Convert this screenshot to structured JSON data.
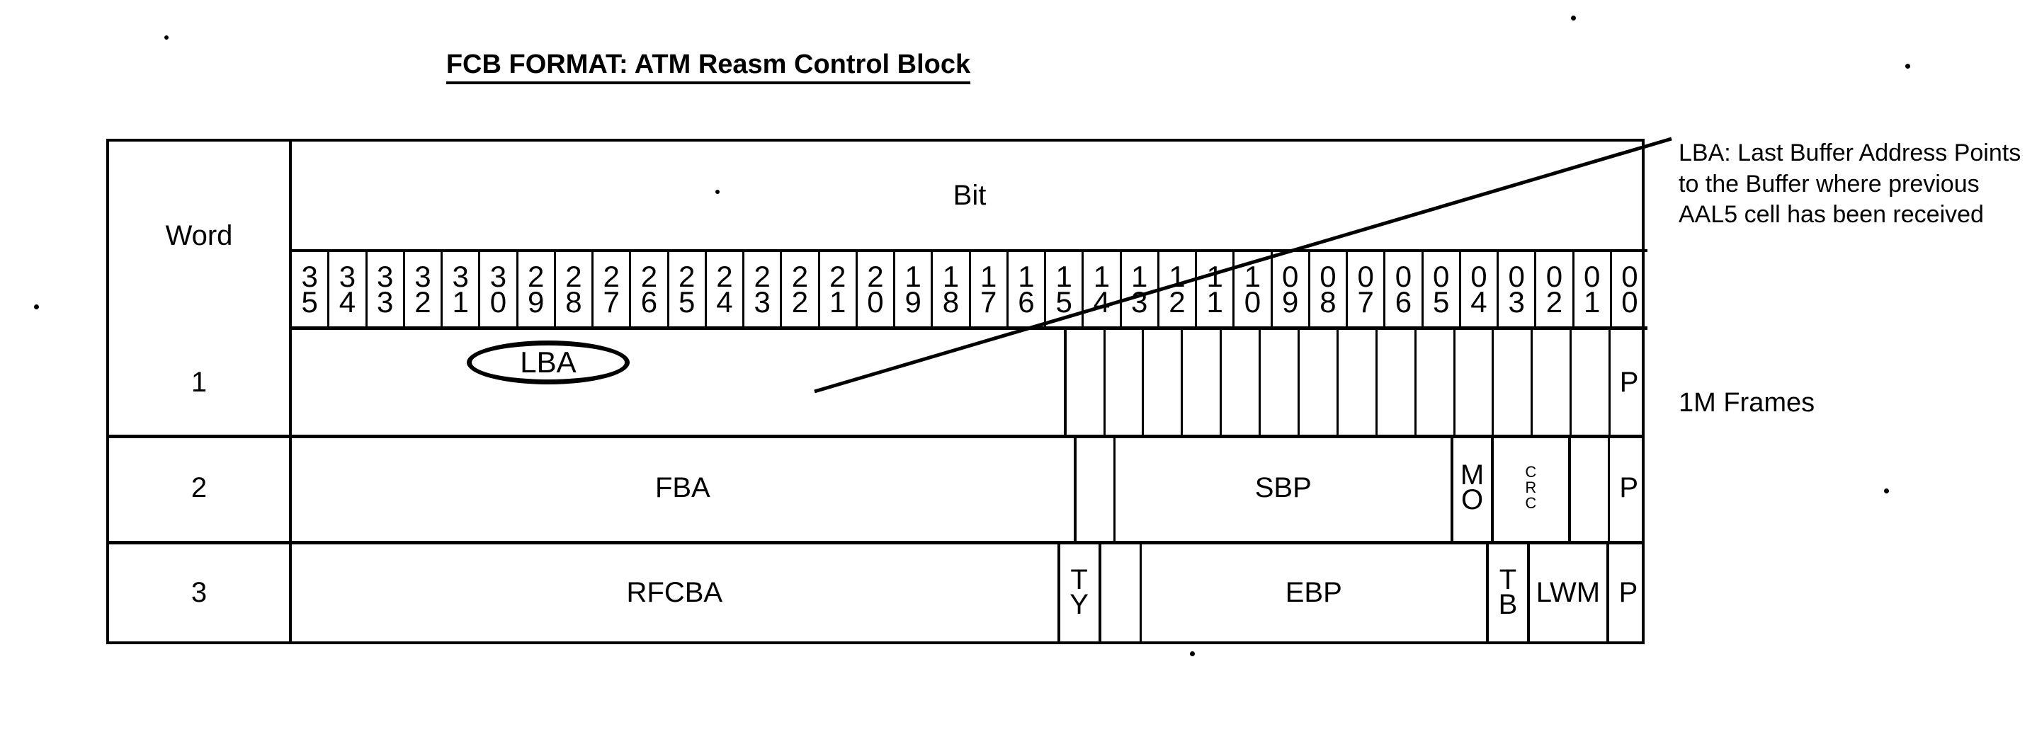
{
  "title": "FCB FORMAT: ATM Reasm Control Block",
  "table": {
    "word_header": "Word",
    "bit_header": "Bit",
    "bit_numbers": [
      "35",
      "34",
      "33",
      "32",
      "31",
      "30",
      "29",
      "28",
      "27",
      "26",
      "25",
      "24",
      "23",
      "22",
      "21",
      "20",
      "19",
      "18",
      "17",
      "16",
      "15",
      "14",
      "13",
      "12",
      "11",
      "10",
      "09",
      "08",
      "07",
      "06",
      "05",
      "04",
      "03",
      "02",
      "01",
      "00"
    ],
    "rows": [
      {
        "word": "1",
        "fields": [
          {
            "label": "LBA",
            "bits": 21,
            "style": "ellipse"
          },
          {
            "label": "",
            "bits": 1,
            "style": "blank"
          },
          {
            "label": "",
            "bits": 1,
            "style": "blank"
          },
          {
            "label": "",
            "bits": 1,
            "style": "blank"
          },
          {
            "label": "",
            "bits": 1,
            "style": "blank"
          },
          {
            "label": "",
            "bits": 1,
            "style": "blank"
          },
          {
            "label": "",
            "bits": 1,
            "style": "blank"
          },
          {
            "label": "",
            "bits": 1,
            "style": "blank"
          },
          {
            "label": "",
            "bits": 1,
            "style": "blank"
          },
          {
            "label": "",
            "bits": 1,
            "style": "blank"
          },
          {
            "label": "",
            "bits": 1,
            "style": "blank"
          },
          {
            "label": "",
            "bits": 1,
            "style": "blank"
          },
          {
            "label": "",
            "bits": 1,
            "style": "blank"
          },
          {
            "label": "",
            "bits": 1,
            "style": "blank"
          },
          {
            "label": "",
            "bits": 1,
            "style": "blank"
          },
          {
            "label": "P",
            "bits": 1,
            "style": "plain"
          }
        ]
      },
      {
        "word": "2",
        "fields": [
          {
            "label": "FBA",
            "bits": 21,
            "style": "plain"
          },
          {
            "label": "",
            "bits": 1,
            "style": "blank"
          },
          {
            "label": "SBP",
            "bits": 9,
            "style": "plain"
          },
          {
            "label": "MO",
            "bits": 1,
            "style": "stack"
          },
          {
            "label": "CRC",
            "bits": 2,
            "style": "tiny"
          },
          {
            "label": "",
            "bits": 1,
            "style": "blank"
          },
          {
            "label": "P",
            "bits": 1,
            "style": "plain"
          }
        ]
      },
      {
        "word": "3",
        "fields": [
          {
            "label": "RFCBA",
            "bits": 20,
            "style": "plain"
          },
          {
            "label": "TY",
            "bits": 1,
            "style": "stack"
          },
          {
            "label": "",
            "bits": 1,
            "style": "blank"
          },
          {
            "label": "EBP",
            "bits": 9,
            "style": "plain"
          },
          {
            "label": "TB",
            "bits": 1,
            "style": "stack"
          },
          {
            "label": "LWM",
            "bits": 2,
            "style": "plain"
          },
          {
            "label": "P",
            "bits": 1,
            "style": "plain"
          }
        ]
      }
    ]
  },
  "annotations": {
    "lba_callout": "LBA: Last Buffer Address Points to the Buffer where previous AAL5 cell has been received",
    "frames_note": "1M Frames"
  }
}
